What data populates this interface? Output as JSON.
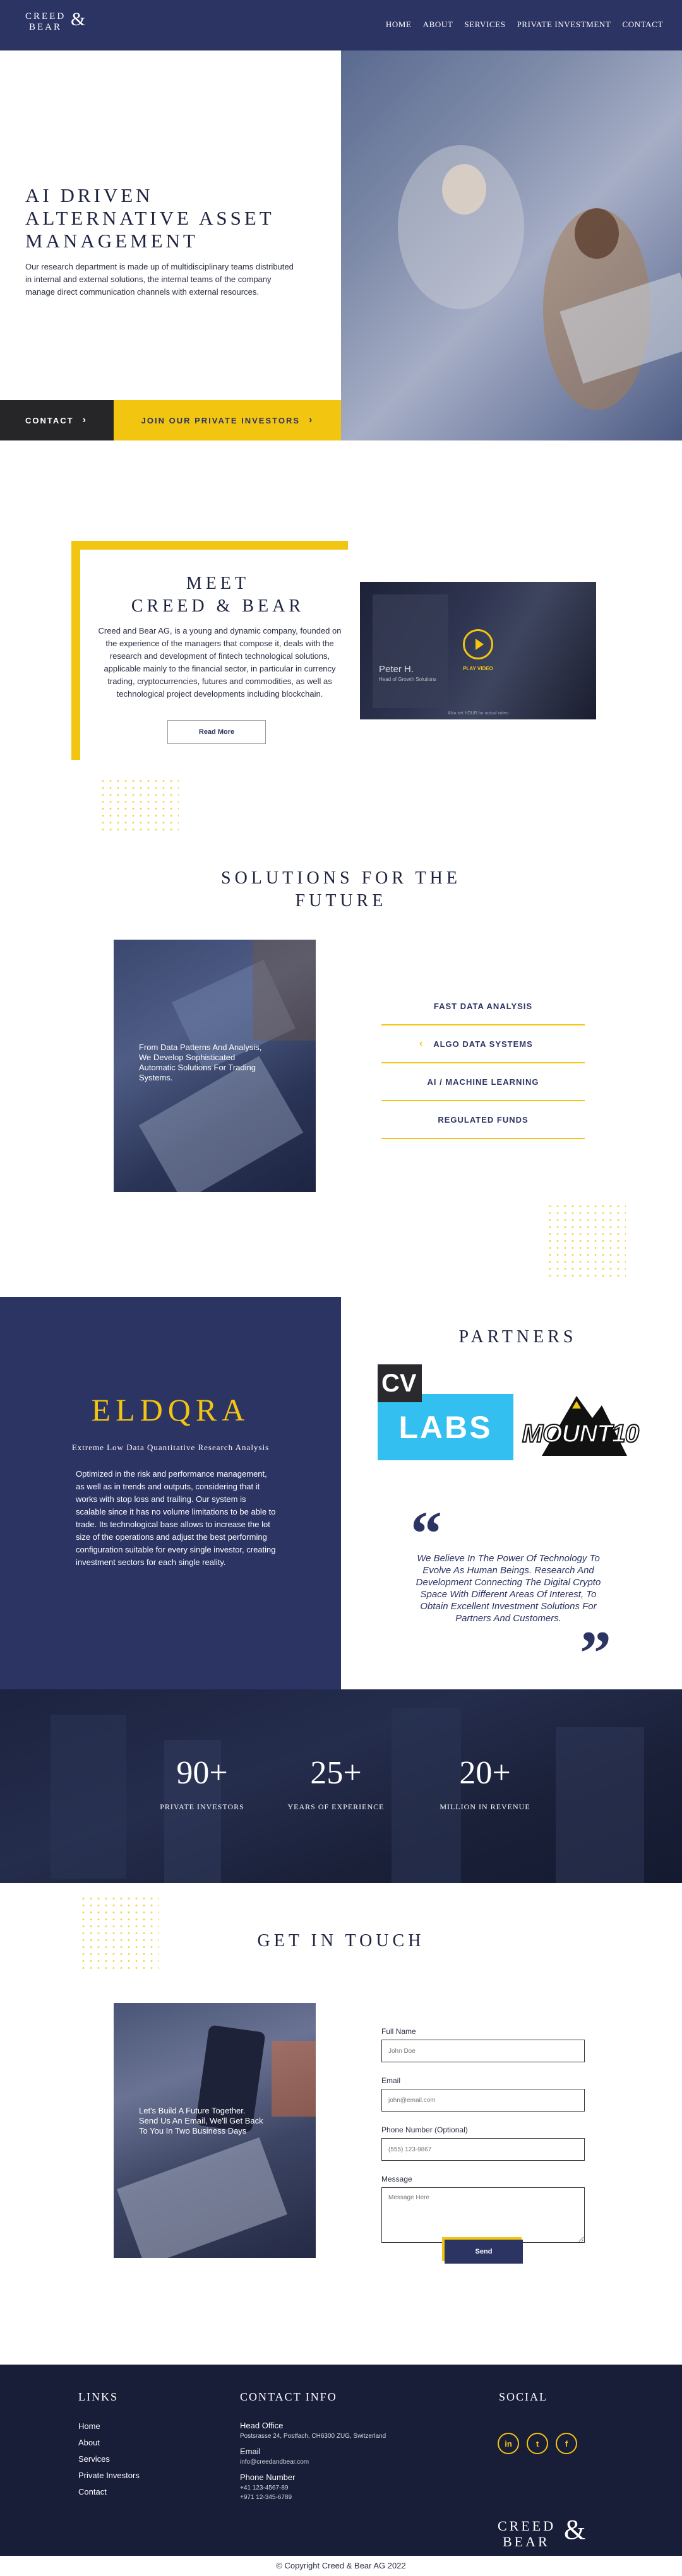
{
  "header": {
    "logo_line1": "CREED",
    "logo_line2": "BEAR",
    "logo_amp": "&",
    "nav": [
      "HOME",
      "ABOUT",
      "SERVICES",
      "PRIVATE INVESTMENT",
      "CONTACT"
    ]
  },
  "hero": {
    "title": "AI DRIVEN ALTERNATIVE ASSET MANAGEMENT",
    "text": "Our research department is made up of multidisciplinary teams distributed in internal and external solutions, the internal teams of the company manage direct communication channels with external resources.",
    "contact_button": "CONTACT",
    "investors_button": "JOIN OUR PRIVATE INVESTORS"
  },
  "meet": {
    "title_line1": "MEET",
    "title_line2": "CREED & BEAR",
    "text": "Creed and Bear AG, is a young and dynamic company, founded on the experience of the managers that compose it, deals with the research and development of fintech technological solutions, applicable mainly to the financial sector, in particular in currency trading, cryptocurrencies, futures and commodities, as well as technological project developments including blockchain.",
    "read_more": "Read More",
    "video": {
      "name": "Peter H.",
      "role": "Head of Growth Solutions",
      "play_label": "PLAY VIDEO",
      "footer": "Also set YOUR for actual video"
    }
  },
  "solutions": {
    "title": "SOLUTIONS FOR THE FUTURE",
    "photo_text": "From Data Patterns And Analysis, We Develop Sophisticated Automatic Solutions For Trading Systems.",
    "items": [
      "FAST DATA ANALYSIS",
      "ALGO DATA SYSTEMS",
      "AI / MACHINE LEARNING",
      "REGULATED FUNDS"
    ],
    "active_index": 1
  },
  "eldqra": {
    "title": "ELDQRA",
    "subtitle": "Extreme Low Data Quantitative Research Analysis",
    "text": "Optimized in the risk and performance management, as well as in trends and outputs, considering that it works with stop loss and trailing. Our system is scalable since it has no volume limitations to be able to trade. Its technological base allows to increase the lot size of the operations and adjust the best performing configuration suitable for every single investor, creating investment sectors for each single reality."
  },
  "partners": {
    "title": "PARTNERS",
    "cv_box": "CV",
    "cv_labs": "LABS",
    "mount": "MOUNT10",
    "quote": "We Believe In The Power Of Technology To Evolve As Human Beings. Research And Development Connecting The Digital Crypto Space With Different Areas Of Interest, To Obtain Excellent Investment Solutions For Partners And Customers."
  },
  "stats": [
    {
      "value": "90+",
      "label": "PRIVATE INVESTORS"
    },
    {
      "value": "25+",
      "label": "YEARS OF EXPERIENCE"
    },
    {
      "value": "20+",
      "label": "MILLION IN REVENUE"
    }
  ],
  "contact": {
    "title": "GET IN TOUCH",
    "photo_text": "Let's Build A Future Together. Send Us An Email, We'll Get Back To You In Two Business Days",
    "fields": [
      {
        "label": "Full Name",
        "placeholder": "John Doe"
      },
      {
        "label": "Email",
        "placeholder": "john@email.com"
      },
      {
        "label": "Phone Number (Optional)",
        "placeholder": "(555) 123-9867"
      },
      {
        "label": "Message",
        "placeholder": "Message Here"
      }
    ],
    "send": "Send"
  },
  "footer": {
    "links_title": "LINKS",
    "links": [
      "Home",
      "About",
      "Services",
      "Private Investors",
      "Contact"
    ],
    "contact_title": "CONTACT INFO",
    "head_office_label": "Head Office",
    "head_office": "Postsrasse 24, Postfach, CH6300 ZUG, Switzerland",
    "email_label": "Email",
    "email": "info@creedandbear.com",
    "phone_label": "Phone Number",
    "phone1": "+41 123-4567-89",
    "phone2": "+971 12-345-6789",
    "social_title": "SOCIAL",
    "social": [
      "in",
      "t",
      "f"
    ],
    "logo_line1": "CREED",
    "logo_line2": "BEAR",
    "logo_amp": "&",
    "copyright": "© Copyright Creed & Bear AG 2022"
  }
}
